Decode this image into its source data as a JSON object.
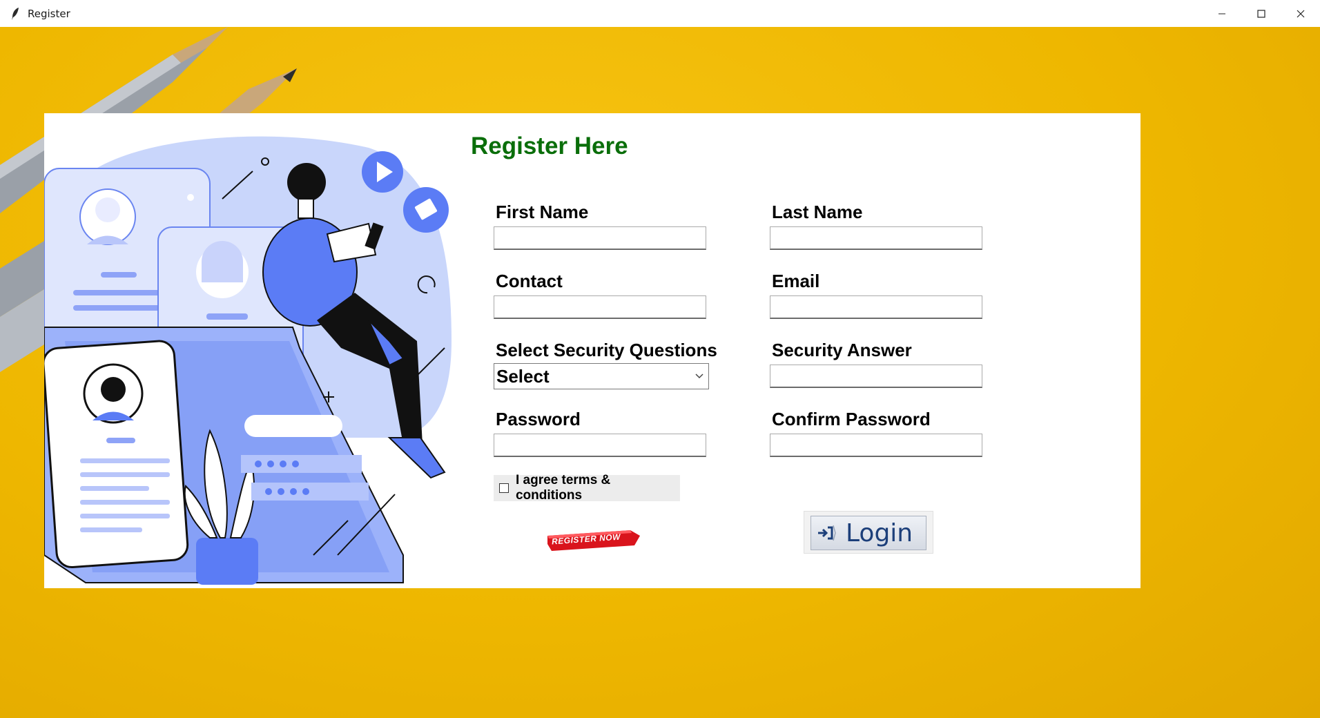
{
  "window": {
    "title": "Register",
    "icon": "feather-icon",
    "controls": [
      "minimize-icon",
      "maximize-icon",
      "close-icon"
    ]
  },
  "form": {
    "title": "Register Here",
    "first_name_label": "First Name",
    "last_name_label": "Last Name",
    "contact_label": "Contact",
    "email_label": "Email",
    "security_question_label": "Select Security Questions",
    "security_question_value": "Select",
    "security_answer_label": "Security Answer",
    "password_label": "Password",
    "confirm_password_label": "Confirm Password",
    "terms_label": "I agree terms & conditions",
    "terms_checked": false,
    "register_label": "REGISTER NOW",
    "login_label": "Login"
  },
  "colors": {
    "title_green": "#0a6e0a",
    "background_yellow": "#eeb700",
    "illustration_blue": "#5b7cf5",
    "register_red": "#d9141c",
    "login_text": "#1c3f7a"
  }
}
